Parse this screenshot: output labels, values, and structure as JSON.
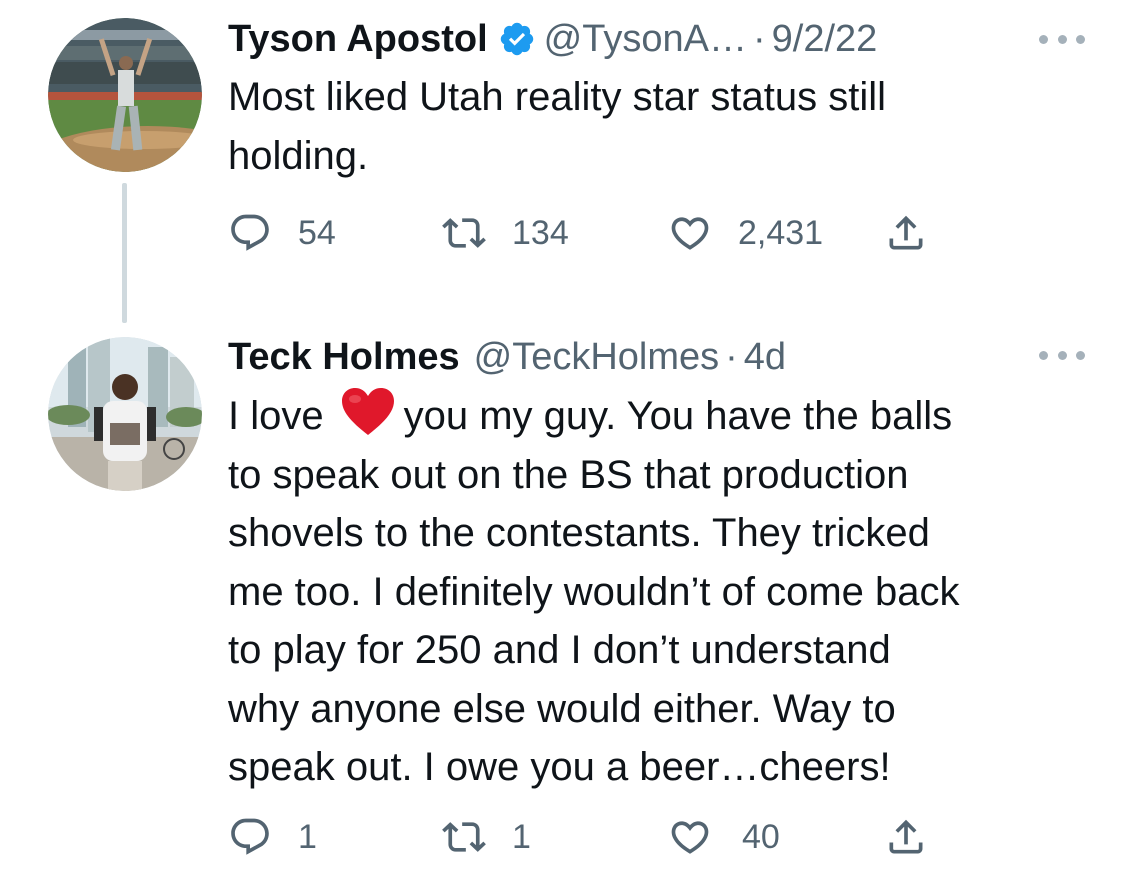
{
  "tweets": [
    {
      "display_name": "Tyson Apostol",
      "verified": true,
      "handle": "@TysonA…",
      "separator": "·",
      "time": "9/2/22",
      "text": "Most liked Utah reality star status still\nholding.",
      "stats": {
        "replies": "54",
        "retweets": "134",
        "likes": "2,431"
      },
      "avatar_icon": "avatar-photo-ballpark"
    },
    {
      "display_name": "Teck Holmes",
      "verified": false,
      "handle": "@TeckHolmes",
      "separator": "·",
      "time": "4d",
      "text_before_emoji": "I love",
      "emoji": "red-heart-emoji",
      "text_after_emoji": "you my guy. You have the balls\nto speak out on the BS that production\nshovels to the contestants. They tricked\nme too. I definitely wouldn’t of come back\nto play for 250 and I don’t understand\nwhy anyone else would either. Way to\nspeak out. I owe you a beer…cheers!",
      "stats": {
        "replies": "1",
        "retweets": "1",
        "likes": "40"
      },
      "avatar_icon": "avatar-photo-street"
    }
  ],
  "colors": {
    "text_primary": "#0f1419",
    "text_secondary": "#536471",
    "verified_blue": "#1d9bf0",
    "thread_line": "#cfd9de",
    "heart_red": "#e0182b"
  },
  "icons": {
    "reply": "reply-icon",
    "retweet": "retweet-icon",
    "like": "like-icon",
    "share": "share-icon",
    "more": "more-icon",
    "verified": "verified-badge-icon"
  }
}
